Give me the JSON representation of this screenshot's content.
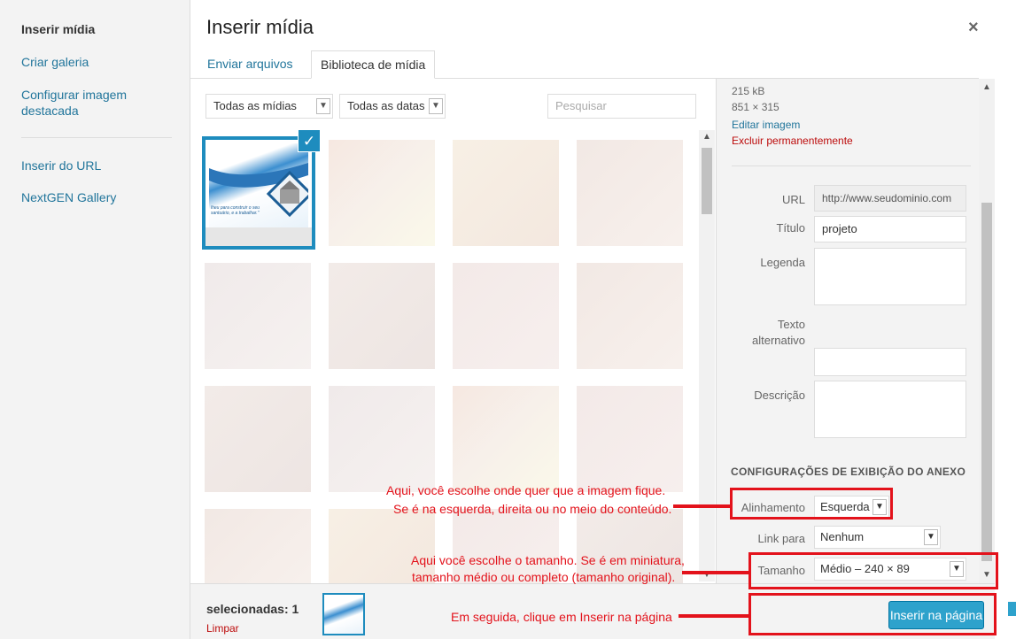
{
  "menu": {
    "items": [
      {
        "label": "Inserir mídia",
        "active": true
      },
      {
        "label": "Criar galeria",
        "active": false
      },
      {
        "label": "Configurar imagem destacada",
        "active": false
      },
      {
        "label": "Inserir do URL",
        "active": false
      },
      {
        "label": "NextGEN Gallery",
        "active": false
      }
    ]
  },
  "header": {
    "title": "Inserir mídia",
    "close_icon": "×",
    "tabs": [
      {
        "label": "Enviar arquivos",
        "active": false
      },
      {
        "label": "Biblioteca de mídia",
        "active": true
      }
    ]
  },
  "filters": {
    "media_type": "Todas as mídias",
    "date": "Todas as datas",
    "search_placeholder": "Pesquisar"
  },
  "grid": {
    "selected_check": "✓",
    "thumb_text": "lheu para construir o seu santuário, e a trabalhar.\""
  },
  "details": {
    "file_size": "215 kB",
    "dimensions": "851 × 315",
    "edit_link": "Editar imagem",
    "delete_link": "Excluir permanentemente",
    "url_label": "URL",
    "url_value": "http://www.seudominio.com",
    "title_label": "Título",
    "title_value": "projeto",
    "caption_label": "Legenda",
    "alt_label": "Texto alternativo",
    "description_label": "Descrição"
  },
  "display_settings": {
    "heading": "CONFIGURAÇÕES DE EXIBIÇÃO DO ANEXO",
    "alignment_label": "Alinhamento",
    "alignment_value": "Esquerda",
    "link_label": "Link para",
    "link_value": "Nenhum",
    "size_label": "Tamanho",
    "size_value": "Médio – 240 × 89"
  },
  "footer": {
    "selected_count": "selecionadas: 1",
    "clear_label": "Limpar",
    "insert_button": "Inserir na página"
  },
  "annotations": {
    "alignment_line1": "Aqui, você escolhe onde quer que a imagem fique.",
    "alignment_line2": "Se é na esquerda, direita ou no meio do conteúdo.",
    "size_line1": "Aqui você escolhe o tamanho. Se é em miniatura,",
    "size_line2": "tamanho médio ou completo (tamanho original).",
    "insert_note": "Em seguida, clique em Inserir na página"
  },
  "colors": {
    "accent": "#21759b",
    "button": "#2ea2cc",
    "selection": "#1e8cbe",
    "annotation": "#e3121b",
    "danger": "#bc0b0b"
  }
}
